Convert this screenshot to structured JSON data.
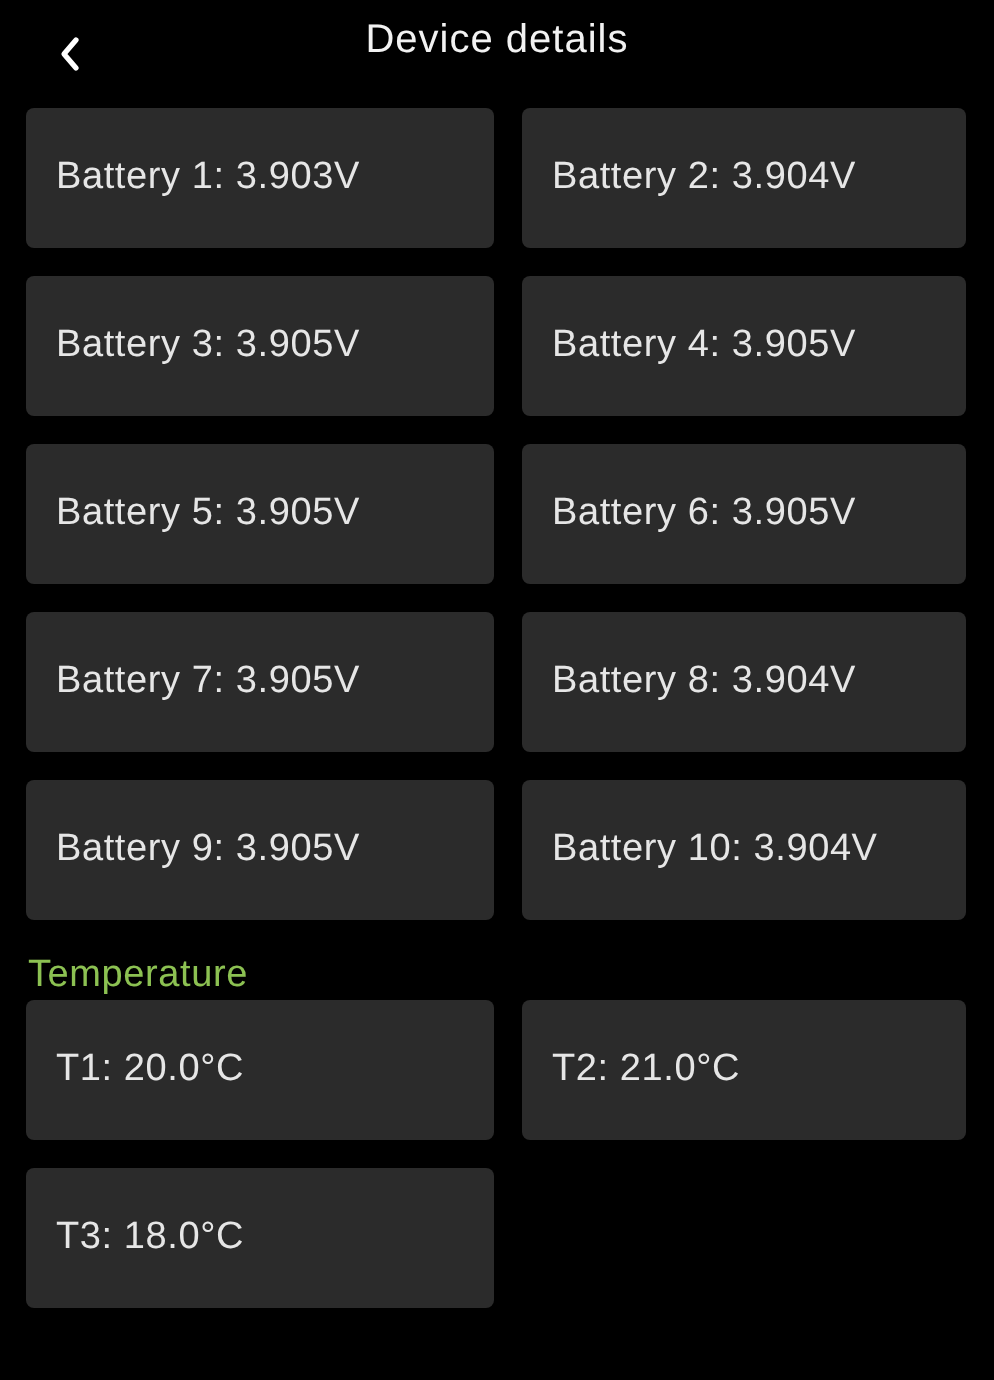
{
  "header": {
    "title": "Device details"
  },
  "batteries": [
    {
      "label": "Battery 1: 3.903V"
    },
    {
      "label": "Battery 2: 3.904V"
    },
    {
      "label": "Battery 3: 3.905V"
    },
    {
      "label": "Battery 4: 3.905V"
    },
    {
      "label": "Battery 5: 3.905V"
    },
    {
      "label": "Battery 6: 3.905V"
    },
    {
      "label": "Battery 7: 3.905V"
    },
    {
      "label": "Battery 8: 3.904V"
    },
    {
      "label": "Battery 9: 3.905V"
    },
    {
      "label": "Battery 10: 3.904V"
    }
  ],
  "temperature": {
    "heading": "Temperature",
    "sensors": [
      {
        "label": "T1: 20.0°C"
      },
      {
        "label": "T2: 21.0°C"
      },
      {
        "label": "T3: 18.0°C"
      }
    ]
  }
}
